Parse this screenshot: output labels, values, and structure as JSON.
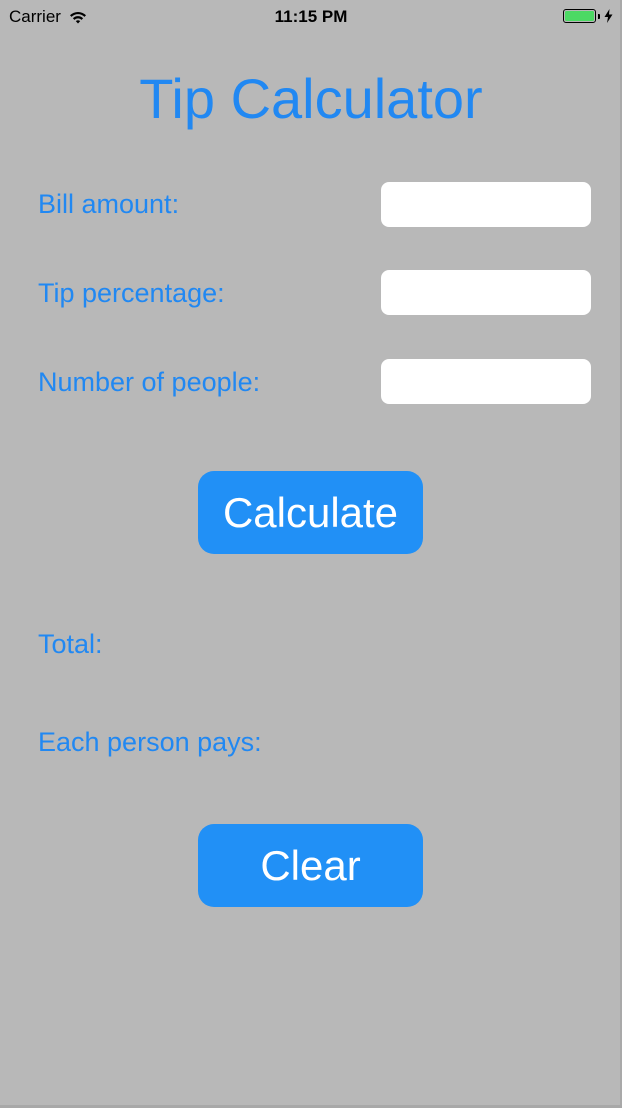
{
  "status_bar": {
    "carrier": "Carrier",
    "time": "11:15 PM",
    "battery_color": "#4cd964",
    "icons": [
      "wifi-icon",
      "battery-icon",
      "charging-bolt-icon"
    ]
  },
  "title": "Tip Calculator",
  "form": {
    "bill_label": "Bill amount:",
    "bill_value": "",
    "tip_label": "Tip percentage:",
    "tip_value": "",
    "people_label": "Number of people:",
    "people_value": ""
  },
  "buttons": {
    "calculate_label": "Calculate",
    "clear_label": "Clear"
  },
  "results": {
    "total_label": "Total:",
    "each_label": "Each person pays:"
  },
  "colors": {
    "background": "#b8b8b8",
    "accent_text": "#2188f2",
    "button_bg": "#2190f6",
    "button_text": "#ffffff",
    "input_bg": "#ffffff"
  }
}
